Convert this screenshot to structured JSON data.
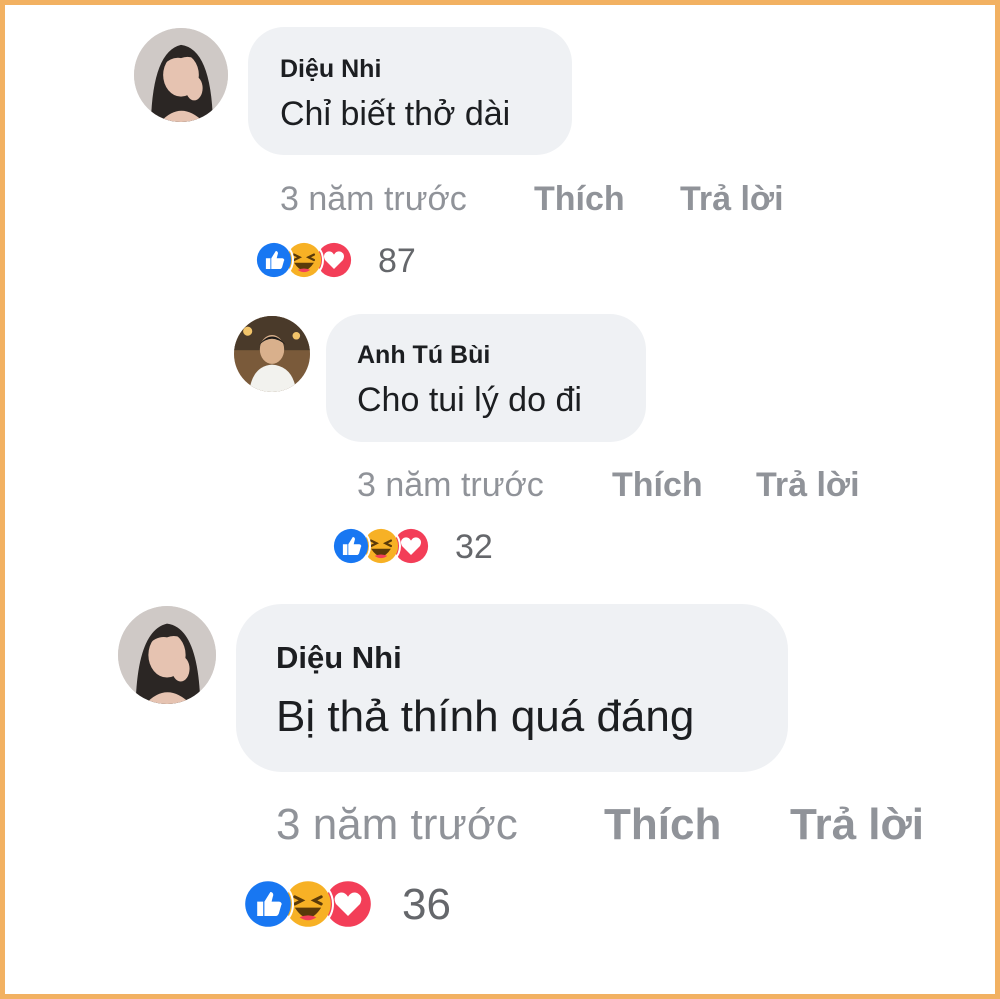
{
  "comments": [
    {
      "author": "Diệu Nhi",
      "text": "Chỉ biết thở dài",
      "time": "3 năm trước",
      "like_label": "Thích",
      "reply_label": "Trả lời",
      "reaction_icons": [
        "like-icon",
        "haha-icon",
        "love-icon"
      ],
      "reaction_count": "87"
    },
    {
      "author": "Anh Tú Bùi",
      "text": "Cho tui lý do đi",
      "time": "3 năm trước",
      "like_label": "Thích",
      "reply_label": "Trả lời",
      "reaction_icons": [
        "like-icon",
        "haha-icon",
        "love-icon"
      ],
      "reaction_count": "32"
    },
    {
      "author": "Diệu Nhi",
      "text": "Bị thả thính quá đáng",
      "time": "3 năm trước",
      "like_label": "Thích",
      "reply_label": "Trả lời",
      "reaction_icons": [
        "like-icon",
        "haha-icon",
        "love-icon"
      ],
      "reaction_count": "36"
    }
  ],
  "colors": {
    "frame": "#f2b162",
    "bubble": "#eff1f4",
    "like": "#1877f2",
    "haha": "#f7b125",
    "love": "#f33e58"
  }
}
